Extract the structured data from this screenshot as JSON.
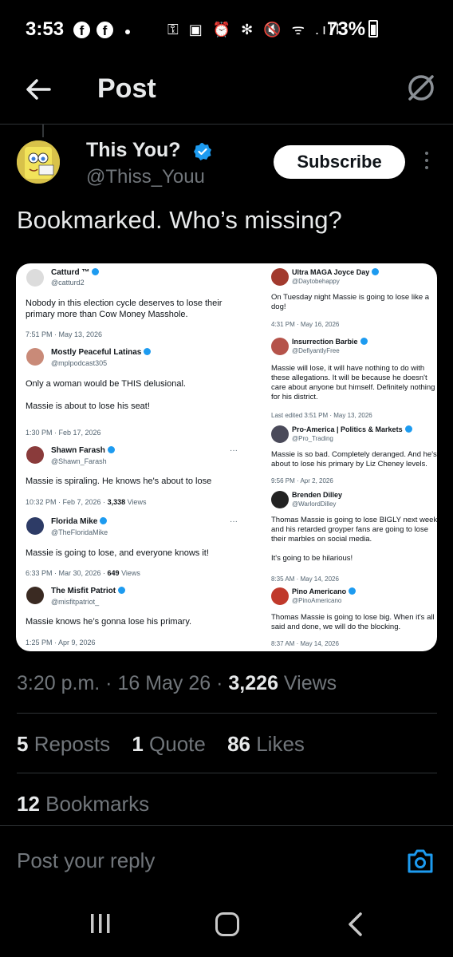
{
  "status_bar": {
    "time": "3:53",
    "fb_icon": "f",
    "icons": "⚿ ▣ ⏰ ✻ 🔇 ᯤ .ıll",
    "battery": "73%"
  },
  "header": {
    "title": "Post"
  },
  "post": {
    "author_name": "This You?",
    "author_handle": "@Thiss_Youu",
    "subscribe_label": "Subscribe",
    "text": "Bookmarked. Who’s missing?",
    "timestamp_prefix": "3:20 p.m. · 16 May 26 · ",
    "views_count": "3,226",
    "views_label": " Views",
    "reposts_count": "5",
    "reposts_label": " Reposts",
    "quotes_count": "1",
    "quotes_label": " Quote",
    "likes_count": "86",
    "likes_label": " Likes",
    "bookmarks_count": "12",
    "bookmarks_label": " Bookmarks"
  },
  "embed": {
    "left": [
      {
        "name": "Catturd ™",
        "handle": "@catturd2",
        "body": "Nobody in this election cycle deserves to lose their primary more than Cow Money Masshole.",
        "meta": "7:51 PM · May 13, 2026",
        "views": "",
        "avatar_color": "#dcdcdc"
      },
      {
        "name": "Mostly Peaceful Latinas",
        "handle": "@mplpodcast305",
        "body": "Only a woman would be THIS delusional.\n\nMassie is about to lose his seat!",
        "meta": "1:30 PM · Feb 17, 2026",
        "views": "",
        "avatar_color": "#c98a78"
      },
      {
        "name": "Shawn Farash",
        "handle": "@Shawn_Farash",
        "body": "Massie is spiraling. He knows he's about to lose",
        "meta": "10:32 PM · Feb 7, 2026 · ",
        "views": "3,338",
        "views_label": " Views",
        "avatar_color": "#8a3b3b"
      },
      {
        "name": "Florida Mike",
        "handle": "@TheFloridaMike",
        "body": "Massie is going to lose, and everyone knows it!",
        "meta": "6:33 PM · Mar 30, 2026 · ",
        "views": "649",
        "views_label": " Views",
        "avatar_color": "#2d3b66"
      },
      {
        "name": "The Misfit Patriot",
        "handle": "@misfitpatriot_",
        "body": "Massie knows he’s gonna lose his primary.",
        "meta": "1:25 PM · Apr 9, 2026",
        "views": "",
        "avatar_color": "#3a2a22"
      }
    ],
    "right": [
      {
        "name": "Ultra MAGA Joyce Day",
        "handle": "@Daytobehappy",
        "body": "On Tuesday night Massie is going to lose like a dog!",
        "meta": "4:31 PM · May 16, 2026",
        "avatar_color": "#a23a2e"
      },
      {
        "name": "Insurrection Barbie",
        "handle": "@DefiyantlyFree",
        "body": "Massie will lose, it will have nothing to do with these allegations. It will be because he doesn't care about anyone but himself. Definitely nothing for his district.",
        "meta": "Last edited 3:51 PM · May 13, 2026",
        "avatar_color": "#b5534a"
      },
      {
        "name": "Pro-America | Politics & Markets",
        "handle": "@Pro_Trading",
        "body": "Massie is so bad. Completely deranged. And he's about to lose his primary by Liz Cheney levels.",
        "meta": "9:56 PM · Apr 2, 2026",
        "avatar_color": "#4a4a5a"
      },
      {
        "name": "Brenden Dilley",
        "handle": "@WarlordDilley",
        "body": "Thomas Massie is going to lose BIGLY next week and his retarded groyper fans are going to lose their marbles on social media.\n\nIt's going to be hilarious!",
        "meta": "8:35 AM · May 14, 2026",
        "avatar_color": "#222222"
      },
      {
        "name": "Pino Americano",
        "handle": "@PinoAmericano",
        "body": "Thomas Massie is going to lose big.  When it's all said and done, we will do the blocking.",
        "meta": "8:37 AM · May 14, 2026",
        "avatar_color": "#c0392b"
      }
    ]
  },
  "reply": {
    "placeholder": "Post your reply"
  },
  "colors": {
    "accent": "#1d9bf0",
    "muted": "#71767b",
    "text": "#e7e9ea"
  }
}
